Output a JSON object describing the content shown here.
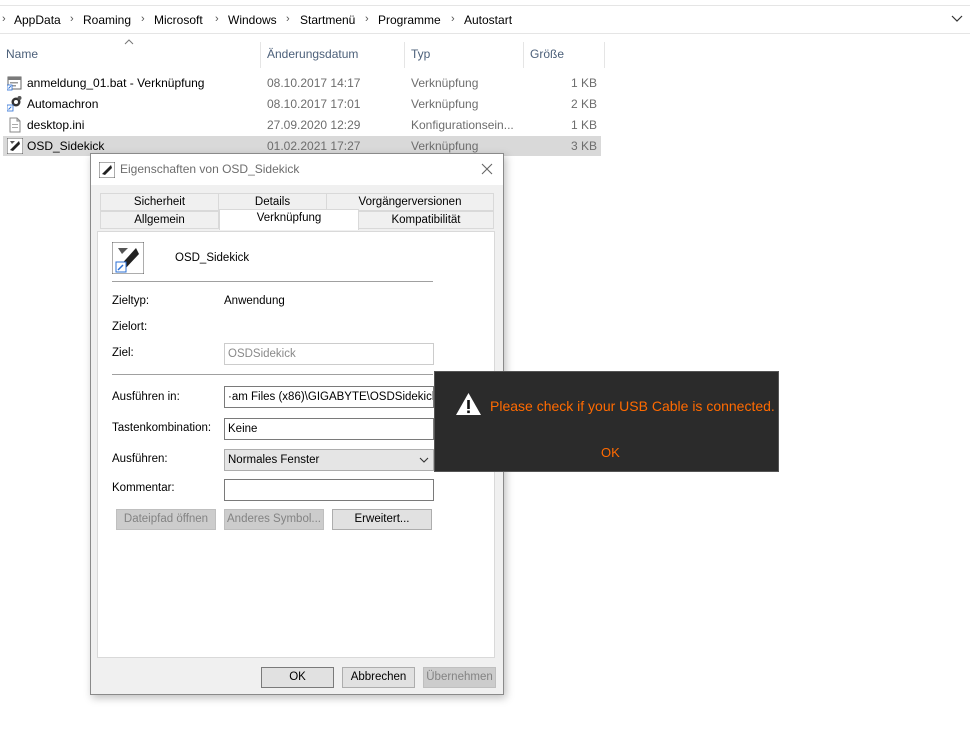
{
  "breadcrumb": [
    "AppData",
    "Roaming",
    "Microsoft",
    "Windows",
    "Startmenü",
    "Programme",
    "Autostart"
  ],
  "columns": {
    "name": "Name",
    "date": "Änderungsdatum",
    "type": "Typ",
    "size": "Größe"
  },
  "files": [
    {
      "name": "anmeldung_01.bat - Verknüpfung",
      "date": "08.10.2017 14:17",
      "type": "Verknüpfung",
      "size": "1 KB",
      "icon": "batch-shortcut-icon"
    },
    {
      "name": "Automachron",
      "date": "08.10.2017 17:01",
      "type": "Verknüpfung",
      "size": "2 KB",
      "icon": "app-shortcut-icon"
    },
    {
      "name": "desktop.ini",
      "date": "27.09.2020 12:29",
      "type": "Konfigurationsein...",
      "size": "1 KB",
      "icon": "ini-file-icon"
    },
    {
      "name": "OSD_Sidekick",
      "date": "01.02.2021 17:27",
      "type": "Verknüpfung",
      "size": "3 KB",
      "icon": "osd-shortcut-icon"
    }
  ],
  "dialog": {
    "title": "Eigenschaften von OSD_Sidekick",
    "tabs_top": [
      "Sicherheit",
      "Details",
      "Vorgängerversionen"
    ],
    "tabs_bottom": [
      "Allgemein",
      "Verknüpfung",
      "Kompatibilität"
    ],
    "shortcut_name": "OSD_Sidekick",
    "labels": {
      "zieltyp": "Zieltyp:",
      "zielort": "Zielort:",
      "ziel": "Ziel:",
      "ausfuehren_in": "Ausführen in:",
      "tastenkombination": "Tastenkombination:",
      "ausfuehren": "Ausführen:",
      "kommentar": "Kommentar:"
    },
    "values": {
      "zieltyp": "Anwendung",
      "zielort": "",
      "ziel": "OSDSidekick",
      "ausfuehren_in": "·am Files (x86)\\GIGABYTE\\OSDSidekick\\\"",
      "tastenkombination": "Keine",
      "ausfuehren": "Normales Fenster",
      "kommentar": ""
    },
    "buttons": {
      "open_path": "Dateipfad öffnen",
      "change_icon": "Anderes Symbol...",
      "advanced": "Erweitert...",
      "ok": "OK",
      "cancel": "Abbrechen",
      "apply": "Übernehmen"
    }
  },
  "toast": {
    "message": "Please check if your USB Cable is connected.",
    "ok": "OK",
    "text_color": "#ff6a00"
  }
}
